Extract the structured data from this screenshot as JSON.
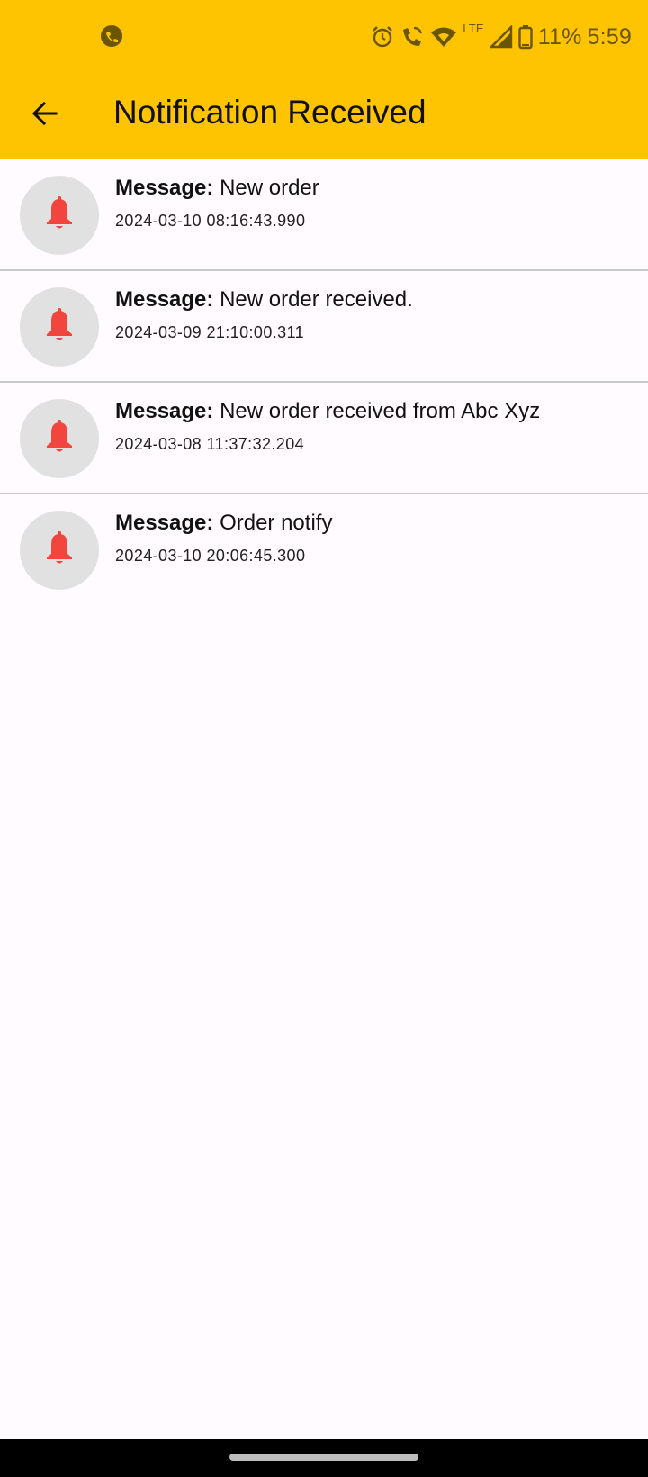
{
  "status_bar": {
    "battery_percent": "11%",
    "time": "5:59",
    "network_label": "LTE",
    "icons": [
      "app-notification-icon",
      "alarm-icon",
      "wifi-calling-icon",
      "wifi-icon",
      "lte-icon",
      "signal-icon",
      "battery-icon"
    ]
  },
  "app_bar": {
    "title": "Notification Received",
    "back_icon": "arrow-back-icon"
  },
  "colors": {
    "header": "#fec301",
    "bell": "#f1453d",
    "avatar_bg": "#e1e1e1",
    "background": "#fffbfe"
  },
  "notifications": [
    {
      "prefix": "Message:",
      "message": "New order",
      "timestamp": "2024-03-10 08:16:43.990",
      "icon": "bell-icon"
    },
    {
      "prefix": "Message:",
      "message": "New order received.",
      "timestamp": "2024-03-09 21:10:00.311",
      "icon": "bell-icon"
    },
    {
      "prefix": "Message:",
      "message": "New order received from Abc Xyz",
      "timestamp": "2024-03-08 11:37:32.204",
      "icon": "bell-icon"
    },
    {
      "prefix": "Message:",
      "message": "Order notify",
      "timestamp": "2024-03-10 20:06:45.300",
      "icon": "bell-icon"
    }
  ]
}
